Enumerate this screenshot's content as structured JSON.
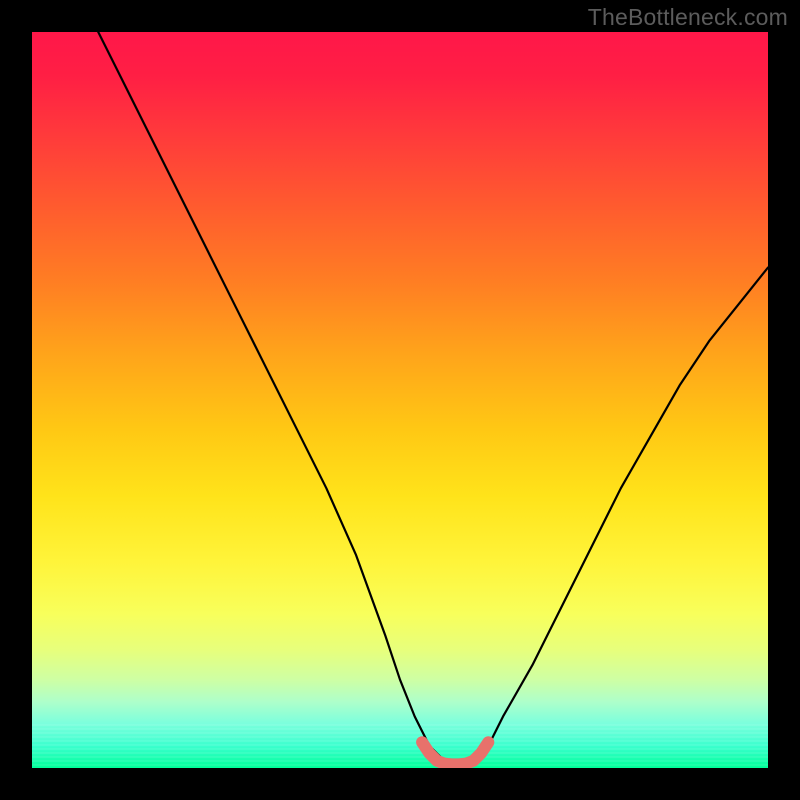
{
  "watermark": "TheBottleneck.com",
  "chart_data": {
    "type": "line",
    "title": "",
    "xlabel": "",
    "ylabel": "",
    "xlim": [
      0,
      100
    ],
    "ylim": [
      0,
      100
    ],
    "series": [
      {
        "name": "bottleneck-curve",
        "x": [
          9,
          12,
          16,
          20,
          24,
          28,
          32,
          36,
          40,
          44,
          48,
          50,
          52,
          54,
          56,
          58,
          59,
          60,
          62,
          64,
          68,
          72,
          76,
          80,
          84,
          88,
          92,
          96,
          100
        ],
        "y": [
          100,
          94,
          86,
          78,
          70,
          62,
          54,
          46,
          38,
          29,
          18,
          12,
          7,
          3,
          1,
          0.5,
          0.5,
          1,
          3,
          7,
          14,
          22,
          30,
          38,
          45,
          52,
          58,
          63,
          68
        ]
      },
      {
        "name": "optimal-range-marker",
        "x": [
          53,
          54,
          55,
          56,
          57,
          58,
          59,
          60,
          61,
          62
        ],
        "y": [
          3.5,
          2,
          1,
          0.6,
          0.5,
          0.5,
          0.6,
          1,
          2,
          3.5
        ]
      }
    ],
    "background_gradient": {
      "top": "#ff1749",
      "mid": "#fff43a",
      "bottom": "#00ff99"
    }
  }
}
